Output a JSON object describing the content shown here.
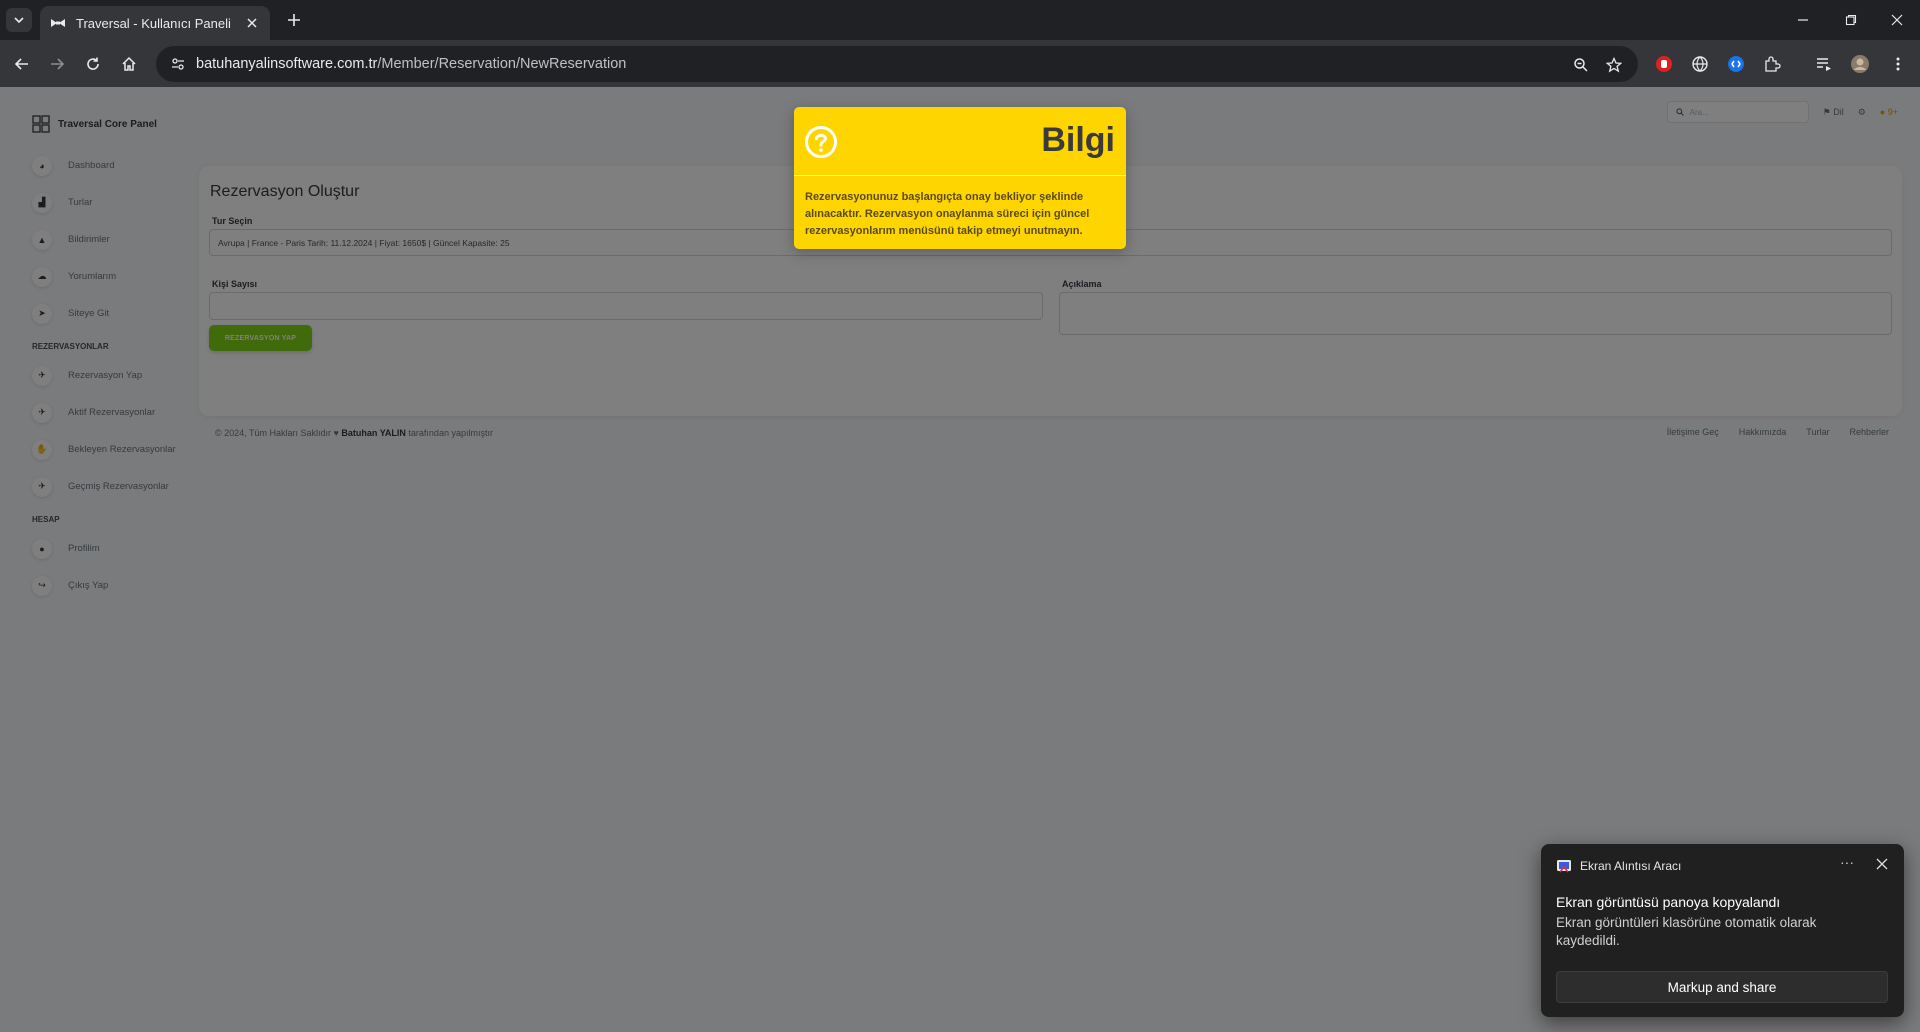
{
  "browser": {
    "tab_title": "Traversal - Kullanıcı Paneli",
    "url_host": "batuhanyalinsoftware.com.tr",
    "url_path": "/Member/Reservation/NewReservation"
  },
  "app": {
    "brand": "Traversal Core Panel",
    "search_placeholder": "Ara...",
    "language_label": "Dil",
    "notification_count": "9+"
  },
  "sidebar": {
    "items": [
      {
        "label": "Dashboard",
        "icon": "dashboard-icon"
      },
      {
        "label": "Turlar",
        "icon": "tours-icon"
      },
      {
        "label": "Bildirimler",
        "icon": "bell-icon"
      },
      {
        "label": "Yorumlarım",
        "icon": "comments-icon"
      },
      {
        "label": "Siteye Git",
        "icon": "send-icon"
      }
    ],
    "section_reservations": "REZERVASYONLAR",
    "reservation_items": [
      {
        "label": "Rezervasyon Yap",
        "icon": "plane-takeoff-icon"
      },
      {
        "label": "Aktif Rezervasyonlar",
        "icon": "plane-icon"
      },
      {
        "label": "Bekleyen Rezervasyonlar",
        "icon": "hand-icon"
      },
      {
        "label": "Geçmiş Rezervasyonlar",
        "icon": "plane-landing-icon"
      }
    ],
    "section_account": "HESAP",
    "account_items": [
      {
        "label": "Profilim",
        "icon": "user-icon"
      },
      {
        "label": "Çıkış Yap",
        "icon": "logout-icon"
      }
    ]
  },
  "form": {
    "title": "Rezervasyon Oluştur",
    "tour_label": "Tur Seçin",
    "tour_value": "Avrupa | France - Paris Tarih: 11.12.2024 | Fiyat: 1650$ | Güncel Kapasite: 25",
    "people_label": "Kişi Sayısı",
    "people_value": "",
    "description_label": "Açıklama",
    "description_value": "",
    "submit_label": "REZERVASYON YAP"
  },
  "footer": {
    "copyright_prefix": "© 2024, Tüm Hakları Saklıdır",
    "author": "Batuhan YALIN",
    "copyright_suffix": "tarafından yapılmıştır",
    "links": [
      "İletişime Geç",
      "Hakkımızda",
      "Turlar",
      "Rehberler"
    ]
  },
  "modal": {
    "title": "Bilgi",
    "message": "Rezervasyonunuz başlangıçta onay bekliyor şeklinde alınacaktır. Rezervasyon onaylanma süreci için güncel rezervasyonlarım menüsünü takip etmeyi unutmayın.",
    "color": "#ffd500"
  },
  "toast": {
    "app_name": "Ekran Alıntısı Aracı",
    "title": "Ekran görüntüsü panoya kopyalandı",
    "body": "Ekran görüntüleri klasörüne otomatik olarak kaydedildi.",
    "action": "Markup and share",
    "more": "···"
  }
}
